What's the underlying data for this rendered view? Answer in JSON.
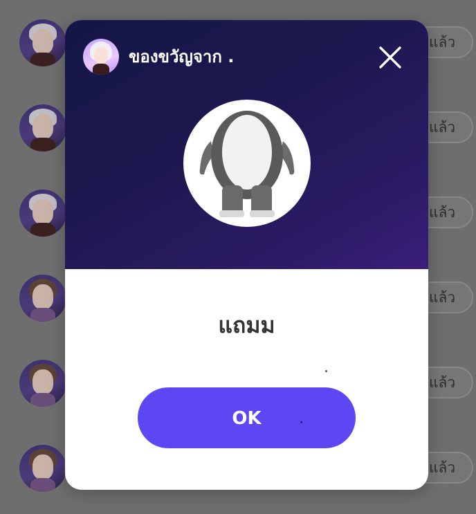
{
  "background_list": {
    "button_label": "แล้ว",
    "rows": [
      {
        "avatar_hair": "light"
      },
      {
        "avatar_hair": "light"
      },
      {
        "avatar_hair": "light"
      },
      {
        "avatar_hair": "brown"
      },
      {
        "avatar_hair": "brown"
      },
      {
        "avatar_hair": "brown"
      }
    ]
  },
  "gift_modal": {
    "sender_label": "ของขวัญจาก .",
    "close_icon": "close-icon",
    "gift_item_name": "แถมม",
    "ok_label": "OK"
  },
  "colors": {
    "header_gradient_start": "#141646",
    "header_gradient_end": "#3a1f7a",
    "ok_button": "#5d47f3",
    "overlay": "#6e6e6e"
  }
}
